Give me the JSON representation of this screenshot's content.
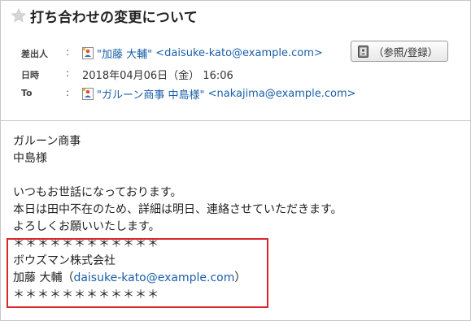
{
  "message": {
    "title": "打ち合わせの変更について"
  },
  "header": {
    "from": {
      "label": "差出人",
      "colon": ":",
      "name": "\"加藤 大輔\"",
      "email": "<daisuke-kato@example.com>",
      "button_label": "（参照/登録）"
    },
    "date": {
      "label": "日時",
      "colon": ":",
      "value": "2018年04月06日（金） 16:06"
    },
    "to": {
      "label": "To",
      "colon": ":",
      "name": "\"ガルーン商事 中島様\"",
      "email": "<nakajima@example.com>"
    }
  },
  "body": {
    "lines": [
      "ガルーン商事",
      "中島様",
      "",
      "いつもお世話になっております。",
      "本日は田中不在のため、詳細は明日、連絡させていただきます。",
      "よろしくお願いいたします。"
    ],
    "signature": {
      "rule_top": "＊＊＊＊＊＊＊＊＊＊＊＊",
      "company": "ボウズマン株式会社",
      "name_prefix": "加藤 大輔（",
      "email": "daisuke-kato@example.com",
      "name_suffix": "）",
      "rule_bottom": "＊＊＊＊＊＊＊＊＊＊＊＊"
    }
  },
  "colors": {
    "link": "#1a5fa8",
    "highlight_border": "#d9262b",
    "border": "#c8c8c8"
  },
  "icons": {
    "star": "star-icon",
    "user": "user-icon",
    "address_book": "address-book-icon"
  }
}
